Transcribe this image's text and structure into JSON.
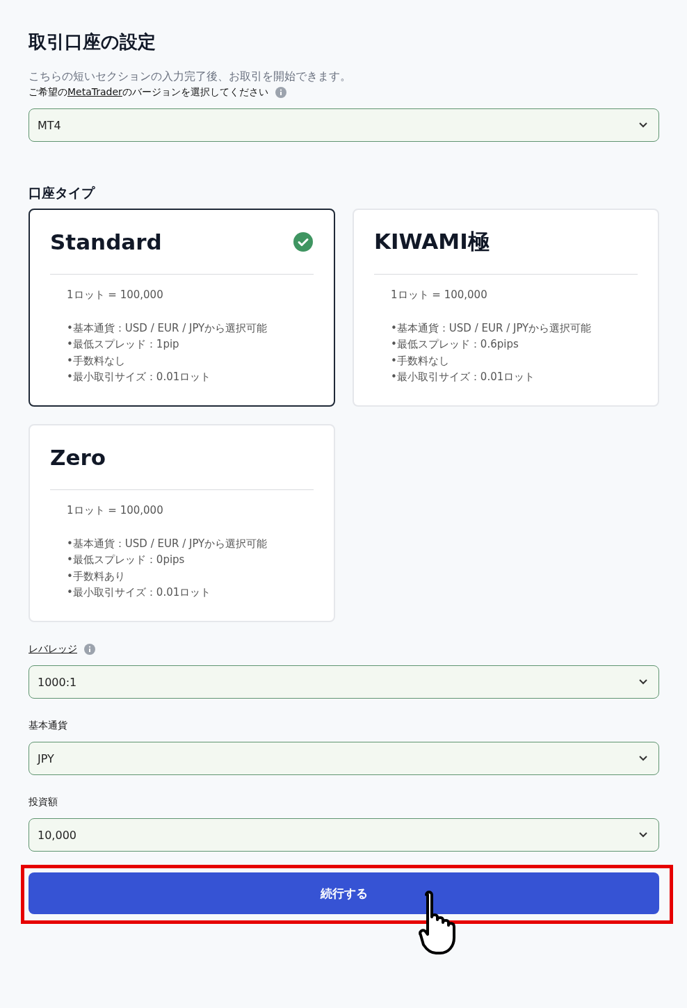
{
  "title": "取引口座の設定",
  "intro": "こちらの短いセクションの入力完了後、お取引を開始できます。",
  "platform": {
    "label_link": "MetaTrader",
    "label_before": "ご希望の",
    "label_after": "のバージョンを選択してください",
    "value": "MT4"
  },
  "account_type": {
    "heading": "口座タイプ",
    "cards": [
      {
        "name": "Standard",
        "selected": true,
        "lot": "1ロット = 100,000",
        "features": [
          "•基本通貨：USD / EUR / JPYから選択可能",
          "•最低スプレッド：1pip",
          "•手数料なし",
          "•最小取引サイズ：0.01ロット"
        ]
      },
      {
        "name": "KIWAMI極",
        "selected": false,
        "lot": "1ロット = 100,000",
        "features": [
          "•基本通貨：USD / EUR / JPYから選択可能",
          "•最低スプレッド：0.6pips",
          "•手数料なし",
          "•最小取引サイズ：0.01ロット"
        ]
      },
      {
        "name": "Zero",
        "selected": false,
        "lot": "1ロット = 100,000",
        "features": [
          "•基本通貨：USD / EUR / JPYから選択可能",
          "•最低スプレッド：0pips",
          "•手数料あり",
          "•最小取引サイズ：0.01ロット"
        ]
      }
    ]
  },
  "fields": [
    {
      "label": "レバレッジ",
      "underlined": true,
      "info": true,
      "value": "1000:1"
    },
    {
      "label": "基本通貨",
      "underlined": false,
      "info": false,
      "value": "JPY"
    },
    {
      "label": "投資額",
      "underlined": false,
      "info": false,
      "value": "10,000"
    }
  ],
  "continue_button": {
    "label": "続行する",
    "highlighted": true
  }
}
